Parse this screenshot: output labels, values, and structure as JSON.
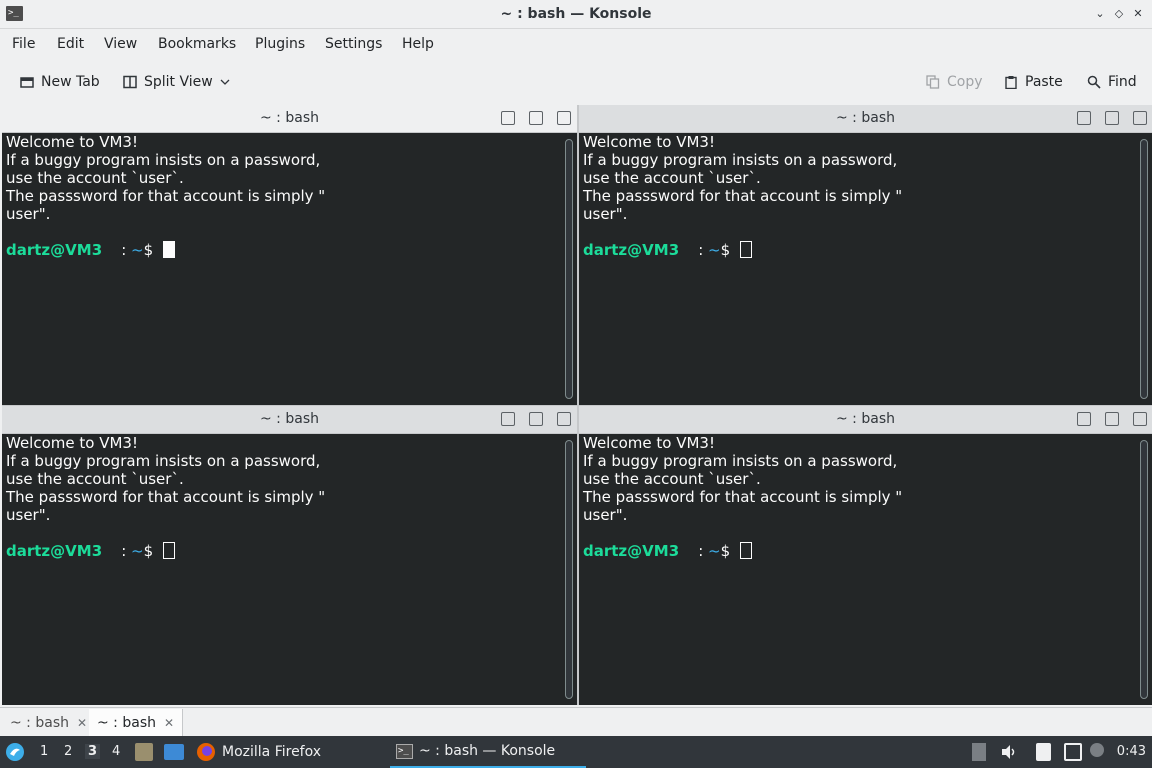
{
  "window": {
    "title": "~ : bash — Konsole",
    "controls": [
      "⌄",
      "◇",
      "✕"
    ]
  },
  "menu": [
    "File",
    "Edit",
    "View",
    "Bookmarks",
    "Plugins",
    "Settings",
    "Help"
  ],
  "toolbar": {
    "new_tab": "New Tab",
    "split_view": "Split View",
    "copy": "Copy",
    "paste": "Paste",
    "find": "Find"
  },
  "panes": [
    {
      "title": "~ : bash",
      "lines": [
        "Welcome to VM3!",
        "If a buggy program insists on a password,",
        "use the account `user`.",
        "The passsword for that account is simply \"",
        "user\"."
      ],
      "prompt_user": "dartz@VM3",
      "prompt_sep": " : ",
      "prompt_path": "~",
      "prompt_end": "$ ",
      "focused": true
    },
    {
      "title": "~ : bash",
      "lines": [
        "Welcome to VM3!",
        "If a buggy program insists on a password,",
        "use the account `user`.",
        "The passsword for that account is simply \"",
        "user\"."
      ],
      "prompt_user": "dartz@VM3",
      "prompt_sep": " : ",
      "prompt_path": "~",
      "prompt_end": "$ ",
      "focused": false
    },
    {
      "title": "~ : bash",
      "lines": [
        "Welcome to VM3!",
        "If a buggy program insists on a password,",
        "use the account `user`.",
        "The passsword for that account is simply \"",
        "user\"."
      ],
      "prompt_user": "dartz@VM3",
      "prompt_sep": " : ",
      "prompt_path": "~",
      "prompt_end": "$ ",
      "focused": false
    },
    {
      "title": "~ : bash",
      "lines": [
        "Welcome to VM3!",
        "If a buggy program insists on a password,",
        "use the account `user`.",
        "The passsword for that account is simply \"",
        "user\"."
      ],
      "prompt_user": "dartz@VM3",
      "prompt_sep": " : ",
      "prompt_path": "~",
      "prompt_end": "$ ",
      "focused": false
    }
  ],
  "tabs": [
    {
      "label": "~ : bash",
      "close": "✕"
    },
    {
      "label": "~ : bash",
      "close": "✕"
    }
  ],
  "taskbar": {
    "workspaces": [
      "1",
      "2",
      "3",
      "4"
    ],
    "active_workspace": "3",
    "tasks": [
      {
        "label": "Mozilla Firefox",
        "icon": "firefox-icon"
      },
      {
        "label": "~ : bash — Konsole",
        "icon": "konsole-icon"
      }
    ],
    "clock": "0:43"
  },
  "colors": {
    "terminal_bg": "#232627",
    "terminal_fg": "#fcfcfc",
    "prompt_user": "#1cdc9a",
    "prompt_path": "#3daee9",
    "accent": "#3daee9"
  }
}
